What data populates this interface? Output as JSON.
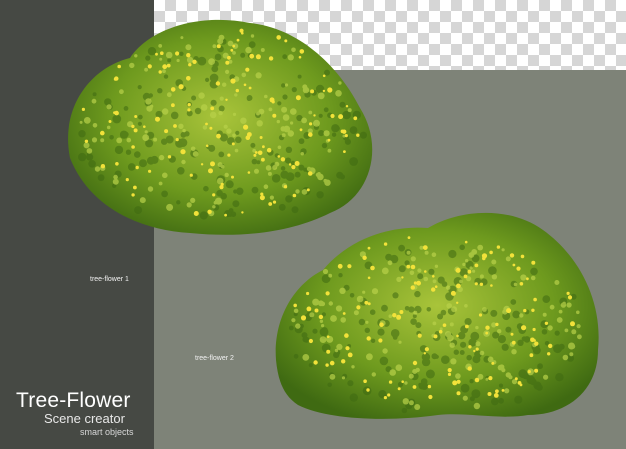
{
  "labels": {
    "flower_1": "tree-flower 1",
    "flower_2": "tree-flower 2"
  },
  "branding": {
    "title": "Tree-Flower",
    "subtitle": "Scene creator",
    "note": "smart objects"
  },
  "colors": {
    "left_panel": "#464944",
    "background": "#7e8378",
    "leaf_dark": "#3f6a12",
    "leaf_mid": "#6e9a1e",
    "leaf_light": "#a9c43a",
    "flower": "#f2e23a"
  }
}
